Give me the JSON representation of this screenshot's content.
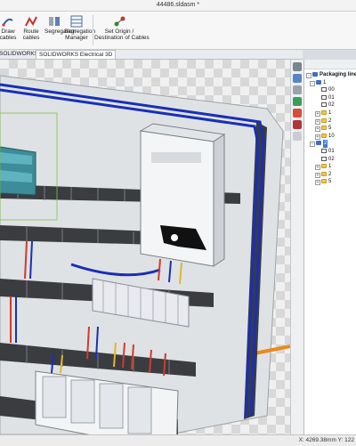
{
  "window": {
    "title": "44486.sldasm *"
  },
  "ribbon": {
    "buttons": [
      {
        "label": "Draw\ncables"
      },
      {
        "label": "Route\ncables"
      },
      {
        "label": "Segregation"
      },
      {
        "label": "Segregation\nManager"
      },
      {
        "label": "Set Origin /\nDestination of Cables"
      }
    ]
  },
  "tabs": [
    {
      "label": "SOLIDWORKS Visualize"
    },
    {
      "label": "SOLIDWORKS Electrical 3D"
    }
  ],
  "tree": {
    "root": "Packaging lines",
    "items": [
      {
        "label": "1",
        "level": 1,
        "type": "assy",
        "expand": "-"
      },
      {
        "label": "00",
        "level": 2,
        "type": "doc"
      },
      {
        "label": "01",
        "level": 2,
        "type": "doc"
      },
      {
        "label": "02",
        "level": 2,
        "type": "doc"
      },
      {
        "label": "1",
        "level": 2,
        "type": "folder",
        "expand": "+"
      },
      {
        "label": "2",
        "level": 2,
        "type": "folder",
        "expand": "+"
      },
      {
        "label": "5",
        "level": 2,
        "type": "folder",
        "expand": "+"
      },
      {
        "label": "10",
        "level": 2,
        "type": "folder",
        "expand": "+"
      },
      {
        "label": "2",
        "level": 1,
        "type": "assy",
        "expand": "-",
        "selected": true
      },
      {
        "label": "01",
        "level": 2,
        "type": "doc"
      },
      {
        "label": "02",
        "level": 2,
        "type": "doc"
      },
      {
        "label": "1",
        "level": 2,
        "type": "folder",
        "expand": "+"
      },
      {
        "label": "2",
        "level": 2,
        "type": "folder",
        "expand": "+"
      },
      {
        "label": "5",
        "level": 2,
        "type": "folder",
        "expand": "+"
      }
    ]
  },
  "status": {
    "coords": "X: 4269.38mm Y: 122"
  },
  "colors": {
    "wire_blue": "#1a2fb5",
    "wire_red": "#d23a2a",
    "duct": "#3a3c40",
    "plate": "#dfe2e4",
    "cable_orange": "#e88a1c",
    "selection_blue": "#3b78d8"
  }
}
